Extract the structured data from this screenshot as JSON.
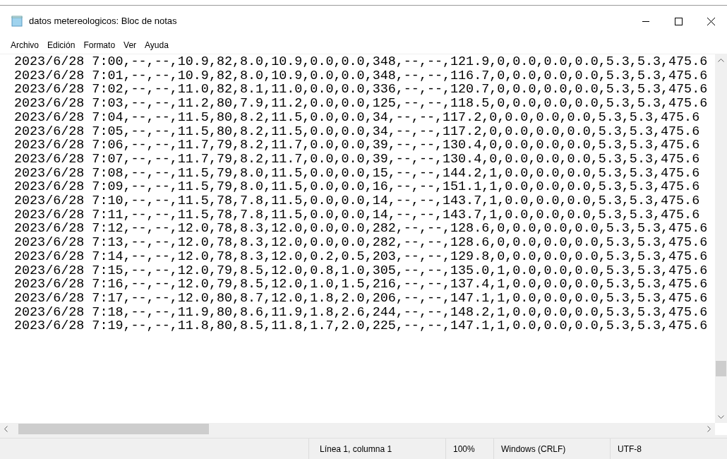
{
  "window": {
    "title": "datos metereologicos: Bloc de notas"
  },
  "menu": [
    "Archivo",
    "Edición",
    "Formato",
    "Ver",
    "Ayuda"
  ],
  "lines": [
    "2023/6/28 7:00,--,--,10.9,82,8.0,10.9,0.0,0.0,348,--,--,121.9,0,0.0,0.0,0.0,5.3,5.3,475.6",
    "2023/6/28 7:01,--,--,10.9,82,8.0,10.9,0.0,0.0,348,--,--,116.7,0,0.0,0.0,0.0,5.3,5.3,475.6",
    "2023/6/28 7:02,--,--,11.0,82,8.1,11.0,0.0,0.0,336,--,--,120.7,0,0.0,0.0,0.0,5.3,5.3,475.6",
    "2023/6/28 7:03,--,--,11.2,80,7.9,11.2,0.0,0.0,125,--,--,118.5,0,0.0,0.0,0.0,5.3,5.3,475.6",
    "2023/6/28 7:04,--,--,11.5,80,8.2,11.5,0.0,0.0,34,--,--,117.2,0,0.0,0.0,0.0,5.3,5.3,475.6",
    "2023/6/28 7:05,--,--,11.5,80,8.2,11.5,0.0,0.0,34,--,--,117.2,0,0.0,0.0,0.0,5.3,5.3,475.6",
    "2023/6/28 7:06,--,--,11.7,79,8.2,11.7,0.0,0.0,39,--,--,130.4,0,0.0,0.0,0.0,5.3,5.3,475.6",
    "2023/6/28 7:07,--,--,11.7,79,8.2,11.7,0.0,0.0,39,--,--,130.4,0,0.0,0.0,0.0,5.3,5.3,475.6",
    "2023/6/28 7:08,--,--,11.5,79,8.0,11.5,0.0,0.0,15,--,--,144.2,1,0.0,0.0,0.0,5.3,5.3,475.6",
    "2023/6/28 7:09,--,--,11.5,79,8.0,11.5,0.0,0.0,16,--,--,151.1,1,0.0,0.0,0.0,5.3,5.3,475.6",
    "2023/6/28 7:10,--,--,11.5,78,7.8,11.5,0.0,0.0,14,--,--,143.7,1,0.0,0.0,0.0,5.3,5.3,475.6",
    "2023/6/28 7:11,--,--,11.5,78,7.8,11.5,0.0,0.0,14,--,--,143.7,1,0.0,0.0,0.0,5.3,5.3,475.6",
    "2023/6/28 7:12,--,--,12.0,78,8.3,12.0,0.0,0.0,282,--,--,128.6,0,0.0,0.0,0.0,5.3,5.3,475.6",
    "2023/6/28 7:13,--,--,12.0,78,8.3,12.0,0.0,0.0,282,--,--,128.6,0,0.0,0.0,0.0,5.3,5.3,475.6",
    "2023/6/28 7:14,--,--,12.0,78,8.3,12.0,0.2,0.5,203,--,--,129.8,0,0.0,0.0,0.0,5.3,5.3,475.6",
    "2023/6/28 7:15,--,--,12.0,79,8.5,12.0,0.8,1.0,305,--,--,135.0,1,0.0,0.0,0.0,5.3,5.3,475.6",
    "2023/6/28 7:16,--,--,12.0,79,8.5,12.0,1.0,1.5,216,--,--,137.4,1,0.0,0.0,0.0,5.3,5.3,475.6",
    "2023/6/28 7:17,--,--,12.0,80,8.7,12.0,1.8,2.0,206,--,--,147.1,1,0.0,0.0,0.0,5.3,5.3,475.6",
    "2023/6/28 7:18,--,--,11.9,80,8.6,11.9,1.8,2.6,244,--,--,148.2,1,0.0,0.0,0.0,5.3,5.3,475.6",
    "2023/6/28 7:19,--,--,11.8,80,8.5,11.8,1.7,2.0,225,--,--,147.1,1,0.0,0.0,0.0,5.3,5.3,475.6"
  ],
  "status_bar": {
    "position": "Línea 1, columna 1",
    "zoom": "100%",
    "line_ending": "Windows (CRLF)",
    "encoding": "UTF-8"
  }
}
